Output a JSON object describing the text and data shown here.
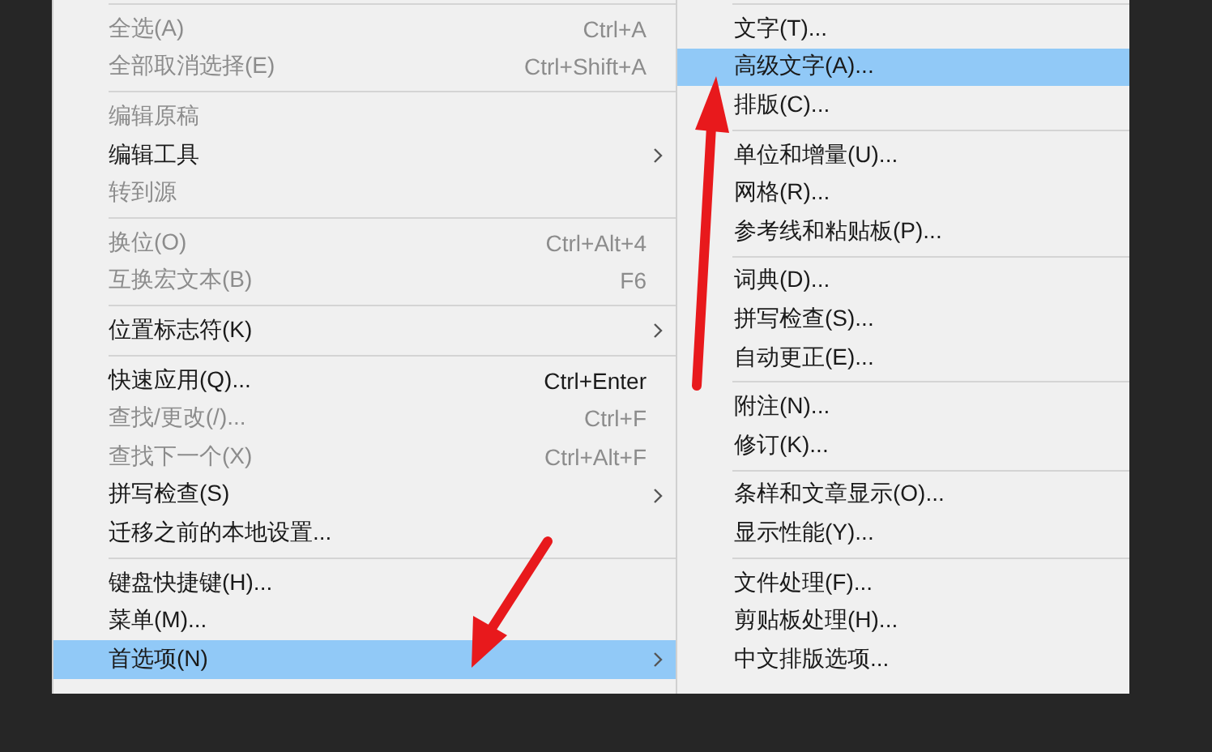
{
  "main_menu": {
    "groups": [
      [
        {
          "label": "全选(A)",
          "shortcut": "Ctrl+A",
          "disabled": true,
          "submenu": false,
          "selected": false
        },
        {
          "label": "全部取消选择(E)",
          "shortcut": "Ctrl+Shift+A",
          "disabled": true,
          "submenu": false,
          "selected": false
        }
      ],
      [
        {
          "label": "编辑原稿",
          "disabled": true,
          "submenu": false,
          "selected": false
        },
        {
          "label": "编辑工具",
          "disabled": false,
          "submenu": true,
          "selected": false
        },
        {
          "label": "转到源",
          "disabled": true,
          "submenu": false,
          "selected": false
        }
      ],
      [
        {
          "label": "换位(O)",
          "shortcut": "Ctrl+Alt+4",
          "disabled": true,
          "submenu": false,
          "selected": false
        },
        {
          "label": "互换宏文本(B)",
          "shortcut": "F6",
          "disabled": true,
          "submenu": false,
          "selected": false
        }
      ],
      [
        {
          "label": "位置标志符(K)",
          "disabled": false,
          "submenu": true,
          "selected": false
        }
      ],
      [
        {
          "label": "快速应用(Q)...",
          "shortcut": "Ctrl+Enter",
          "disabled": false,
          "submenu": false,
          "selected": false
        },
        {
          "label": "查找/更改(/)...",
          "shortcut": "Ctrl+F",
          "disabled": true,
          "submenu": false,
          "selected": false
        },
        {
          "label": "查找下一个(X)",
          "shortcut": "Ctrl+Alt+F",
          "disabled": true,
          "submenu": false,
          "selected": false
        },
        {
          "label": "拼写检查(S)",
          "disabled": false,
          "submenu": true,
          "selected": false
        },
        {
          "label": "迁移之前的本地设置...",
          "disabled": false,
          "submenu": false,
          "selected": false
        }
      ],
      [
        {
          "label": "键盘快捷键(H)...",
          "disabled": false,
          "submenu": false,
          "selected": false
        },
        {
          "label": "菜单(M)...",
          "disabled": false,
          "submenu": false,
          "selected": false
        },
        {
          "label": "首选项(N)",
          "disabled": false,
          "submenu": true,
          "selected": true
        }
      ]
    ]
  },
  "submenu": {
    "groups": [
      [
        {
          "label": "文字(T)...",
          "selected": false
        },
        {
          "label": "高级文字(A)...",
          "selected": true
        },
        {
          "label": "排版(C)...",
          "selected": false
        }
      ],
      [
        {
          "label": "单位和增量(U)...",
          "selected": false
        },
        {
          "label": "网格(R)...",
          "selected": false
        },
        {
          "label": "参考线和粘贴板(P)...",
          "selected": false
        }
      ],
      [
        {
          "label": "词典(D)...",
          "selected": false
        },
        {
          "label": "拼写检查(S)...",
          "selected": false
        },
        {
          "label": "自动更正(E)...",
          "selected": false
        }
      ],
      [
        {
          "label": "附注(N)...",
          "selected": false
        },
        {
          "label": "修订(K)...",
          "selected": false
        }
      ],
      [
        {
          "label": "条样和文章显示(O)...",
          "selected": false
        },
        {
          "label": "显示性能(Y)...",
          "selected": false
        }
      ],
      [
        {
          "label": "文件处理(F)...",
          "selected": false
        },
        {
          "label": "剪贴板处理(H)...",
          "selected": false
        },
        {
          "label": "中文排版选项...",
          "selected": false
        }
      ]
    ]
  }
}
